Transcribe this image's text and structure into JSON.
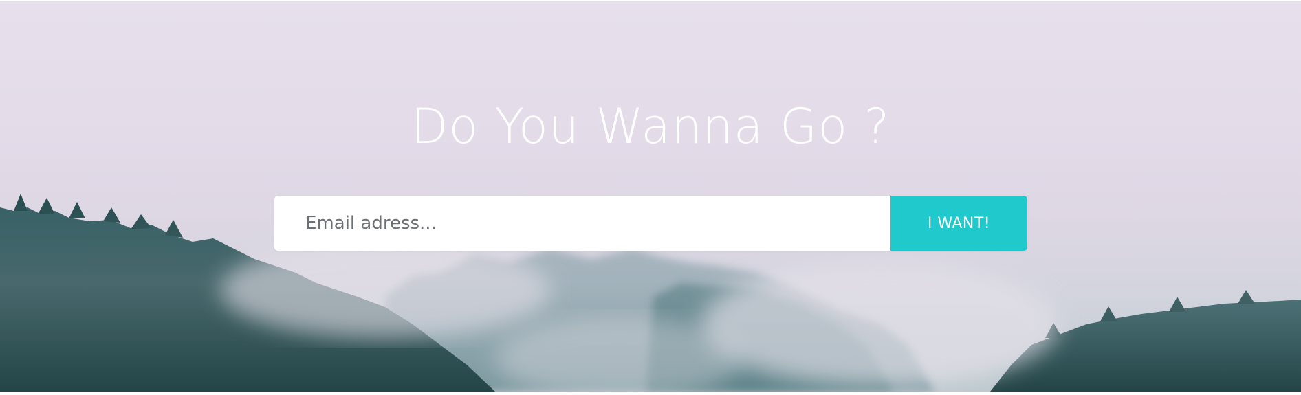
{
  "hero": {
    "title": "Do You Wanna Go ?"
  },
  "subscribe": {
    "email_placeholder": "Email adress...",
    "email_value": "",
    "submit_label": "I WANT!",
    "accent_color": "#20c9cc"
  },
  "background": {
    "scene": "misty-forest-hills",
    "sky_color": "#e6dfeb",
    "forest_color": "#1f4a4f"
  }
}
